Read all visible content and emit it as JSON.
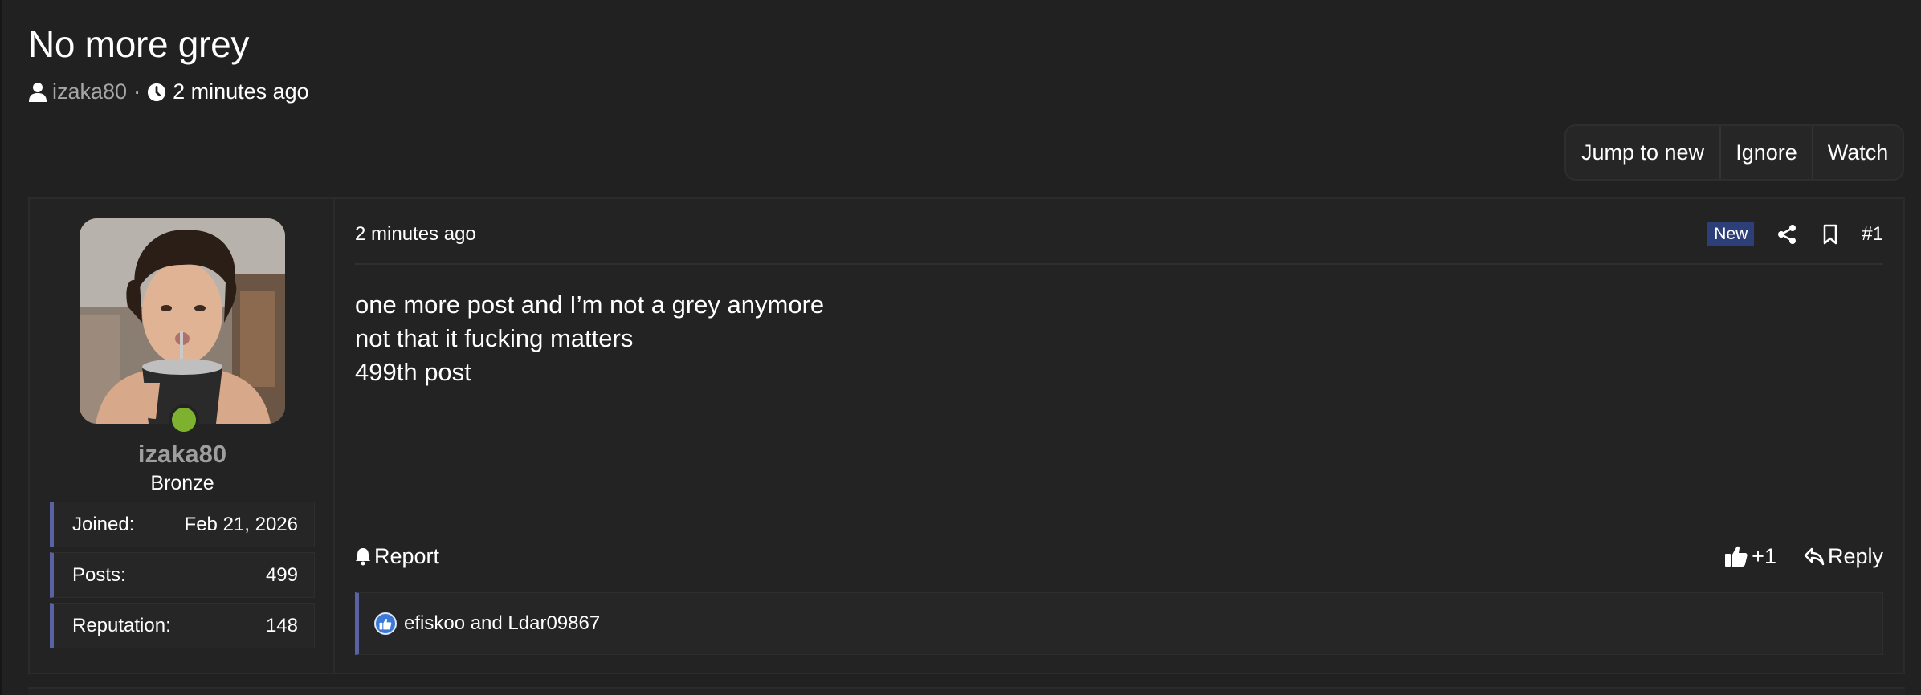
{
  "thread": {
    "title": "No more grey",
    "author": "izaka80",
    "separator": "·",
    "time": "2 minutes ago"
  },
  "toolbar": {
    "jump_label": "Jump to new",
    "ignore_label": "Ignore",
    "watch_label": "Watch"
  },
  "user": {
    "name": "izaka80",
    "title": "Bronze",
    "online": true,
    "stats": [
      {
        "label": "Joined:",
        "value": "Feb 21, 2026"
      },
      {
        "label": "Posts:",
        "value": "499"
      },
      {
        "label": "Reputation:",
        "value": "148"
      }
    ]
  },
  "post": {
    "date": "2 minutes ago",
    "badge": "New",
    "number": "#1",
    "lines": [
      "one more post and I’m not a grey anymore",
      "not that it fucking matters",
      "499th post"
    ],
    "report_label": "Report",
    "like_label": "+1",
    "reply_label": "Reply",
    "reactions_text": "efiskoo and Ldar09867"
  },
  "icons": {
    "author": "user-icon",
    "time": "clock-icon",
    "share": "share-icon",
    "bookmark": "bookmark-icon",
    "report": "bell-icon",
    "like": "thumbs-up-icon",
    "reply": "reply-icon"
  },
  "colors": {
    "background": "#212121",
    "accent": "#5a62a6",
    "badge_new": "#2d3f78",
    "online": "#7fb131",
    "like": "#3c78d8"
  }
}
